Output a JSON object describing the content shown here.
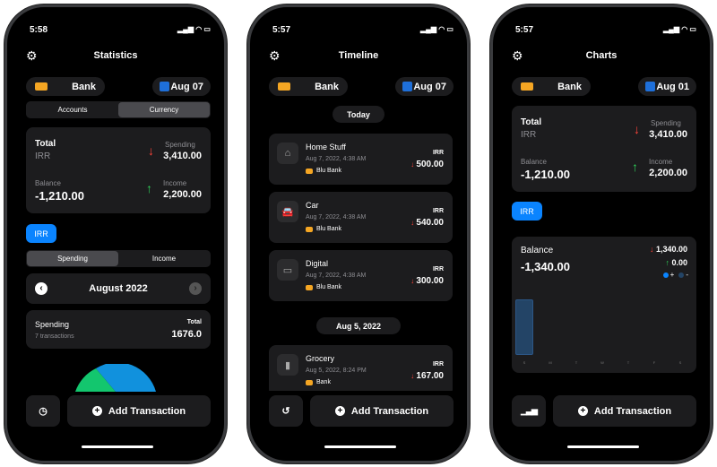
{
  "phones": [
    {
      "time": "5:58",
      "title": "Statistics",
      "account": "Bank",
      "date": "Aug 07",
      "tabs": [
        "Accounts",
        "Currency"
      ],
      "summary": {
        "total_label": "Total",
        "currency": "IRR",
        "spending_label": "Spending",
        "spending": "3,410.00",
        "balance_label": "Balance",
        "balance": "-1,210.00",
        "income_label": "Income",
        "income": "2,200.00"
      },
      "currency_button": "IRR",
      "type_tabs": [
        "Spending",
        "Income"
      ],
      "month": "August 2022",
      "spending_card": {
        "label": "Spending",
        "count": "7 transactions",
        "total_label": "Total",
        "total": "1676.0"
      },
      "add_label": "Add Transaction"
    },
    {
      "time": "5:57",
      "title": "Timeline",
      "account": "Bank",
      "date": "Aug 07",
      "groups": [
        {
          "label": "Today",
          "items": [
            {
              "name": "Home Stuff",
              "icon": "house-icon",
              "date": "Aug 7, 2022, 4:38 AM",
              "account": "Blu Bank",
              "currency": "IRR",
              "amount": "500.00"
            },
            {
              "name": "Car",
              "icon": "car-icon",
              "date": "Aug 7, 2022, 4:38 AM",
              "account": "Blu Bank",
              "currency": "IRR",
              "amount": "540.00"
            },
            {
              "name": "Digital",
              "icon": "battery-icon",
              "date": "Aug 7, 2022, 4:38 AM",
              "account": "Blu Bank",
              "currency": "IRR",
              "amount": "300.00"
            }
          ]
        },
        {
          "label": "Aug 5, 2022",
          "items": [
            {
              "name": "Grocery",
              "icon": "bag-icon",
              "date": "Aug 5, 2022, 8:24 PM",
              "account": "Bank",
              "currency": "IRR",
              "amount": "167.00"
            }
          ]
        }
      ],
      "add_label": "Add Transaction"
    },
    {
      "time": "5:57",
      "title": "Charts",
      "account": "Bank",
      "date": "Aug 01",
      "summary": {
        "total_label": "Total",
        "currency": "IRR",
        "spending_label": "Spending",
        "spending": "3,410.00",
        "balance_label": "Balance",
        "balance": "-1,210.00",
        "income_label": "Income",
        "income": "2,200.00"
      },
      "currency_button": "IRR",
      "chart": {
        "label": "Balance",
        "balance": "-1,340.00",
        "out": "1,340.00",
        "in": "0.00",
        "legend_plus": "+",
        "legend_minus": "-",
        "days": [
          "S",
          "M",
          "T",
          "W",
          "T",
          "F",
          "S"
        ],
        "values_minus": [
          1340,
          0,
          0,
          0,
          0,
          0,
          0
        ],
        "values_plus": [
          0,
          0,
          0,
          0,
          0,
          0,
          0
        ]
      },
      "add_label": "Add Transaction"
    }
  ],
  "colors": {
    "accent": "#0a84ff",
    "spending": "#ff453a",
    "income": "#30d158",
    "bar_minus": "#234466"
  }
}
